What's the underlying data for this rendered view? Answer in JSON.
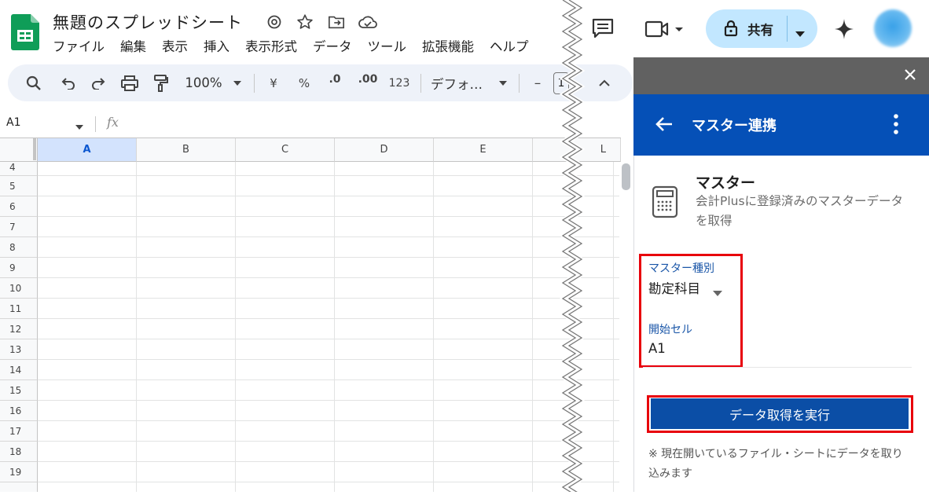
{
  "doc": {
    "title": "無題のスプレッドシート"
  },
  "menu": [
    "ファイル",
    "編集",
    "表示",
    "挿入",
    "表示形式",
    "データ",
    "ツール",
    "拡張機能",
    "ヘルプ"
  ],
  "toolbar": {
    "zoom": "100%",
    "currency": "¥",
    "percent": "%",
    "dec_decrease": ".0",
    "dec_increase": ".00",
    "number_format": "123",
    "font": "デフォ…",
    "font_minus": "–",
    "font_size": "1"
  },
  "formula_bar": {
    "cell_ref": "A1",
    "fx": "fx"
  },
  "grid": {
    "columns": [
      "A",
      "B",
      "C",
      "D",
      "E",
      "L"
    ],
    "rows": [
      "4",
      "5",
      "6",
      "7",
      "8",
      "9",
      "10",
      "11",
      "12",
      "13",
      "14",
      "15",
      "16",
      "17",
      "18",
      "19"
    ]
  },
  "share": {
    "label": "共有"
  },
  "panel": {
    "title": "マスター連携",
    "section_title": "マスター",
    "section_desc": "会計Plusに登録済みのマスターデータを取得",
    "master_type_label": "マスター種別",
    "master_type_value": "勘定科目",
    "start_cell_label": "開始セル",
    "start_cell_value": "A1",
    "run_button": "データ取得を実行",
    "note": "※ 現在開いているファイル・シートにデータを取り込みます"
  },
  "colors": {
    "header_blue": "#0550b7",
    "button_blue": "#0b4ea6",
    "highlight_red": "#e8000b",
    "share_bg": "#c2e7ff"
  }
}
